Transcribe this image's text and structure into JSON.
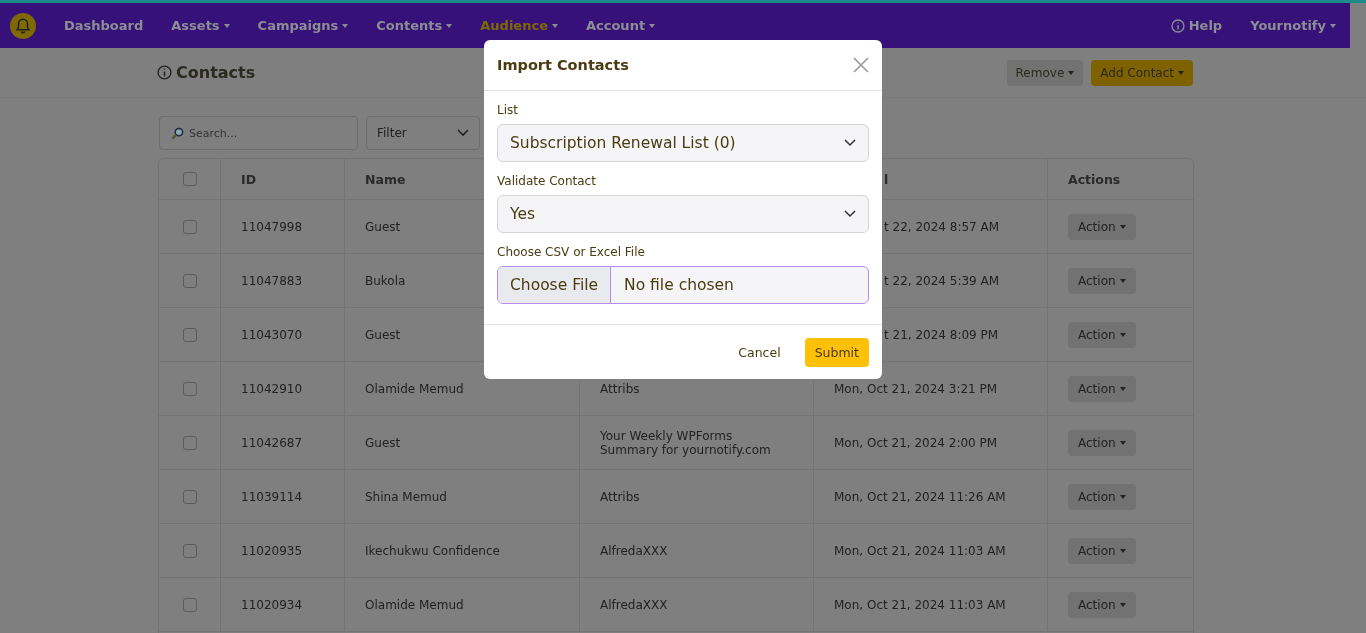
{
  "nav": {
    "items": [
      {
        "label": "Dashboard",
        "dropdown": false,
        "selected": false
      },
      {
        "label": "Assets",
        "dropdown": true,
        "selected": false
      },
      {
        "label": "Campaigns",
        "dropdown": true,
        "selected": false
      },
      {
        "label": "Contents",
        "dropdown": true,
        "selected": false
      },
      {
        "label": "Audience",
        "dropdown": true,
        "selected": true
      },
      {
        "label": "Account",
        "dropdown": true,
        "selected": false
      }
    ],
    "help": "Help",
    "account": "Yournotify"
  },
  "page": {
    "title": "Contacts",
    "buttons": [
      {
        "label": "Remove",
        "kind": "secondary"
      },
      {
        "label": "Add Contact",
        "kind": "primary"
      }
    ]
  },
  "toolbar": {
    "search": {
      "placeholder": "Search..."
    },
    "filter": {
      "value": "Filter"
    }
  },
  "table": {
    "header_checked": false,
    "columns": [
      "ID",
      "Name",
      "",
      "l",
      "Actions"
    ],
    "rows": [
      {
        "checked": false,
        "id": "11047998",
        "name": "Guest",
        "column_4": "t 22, 2024 8:57 AM",
        "action": "Action"
      },
      {
        "checked": false,
        "id": "11047883",
        "name": "Bukola",
        "column_4": "t 22, 2024 5:39 AM",
        "action": "Action"
      },
      {
        "checked": false,
        "id": "11043070",
        "name": "Guest",
        "column_4": "t 21, 2024 8:09 PM",
        "action": "Action"
      },
      {
        "checked": false,
        "id": "11042910",
        "name": "Olamide Memud",
        "column_3": "Attribs",
        "column_4": "Mon, Oct 21, 2024 3:21 PM",
        "action": "Action"
      },
      {
        "checked": false,
        "id": "11042687",
        "name": "Guest",
        "column_3": "Your Weekly WPForms Summary for yournotify.com",
        "column_4": "Mon, Oct 21, 2024 2:00 PM",
        "action": "Action"
      },
      {
        "checked": false,
        "id": "11039114",
        "name": "Shina Memud",
        "column_3": "Attribs",
        "column_4": "Mon, Oct 21, 2024 11:26 AM",
        "action": "Action"
      },
      {
        "checked": false,
        "id": "11020935",
        "name": "Ikechukwu Confidence",
        "column_3": "AlfredaXXX",
        "column_4": "Mon, Oct 21, 2024 11:03 AM",
        "action": "Action"
      },
      {
        "checked": false,
        "id": "11020934",
        "name": "Olamide Memud",
        "column_3": "AlfredaXXX",
        "column_4": "Mon, Oct 21, 2024 11:03 AM",
        "action": "Action"
      }
    ]
  },
  "modal": {
    "title": "Import Contacts",
    "fields": [
      {
        "kind": "select",
        "label": "List",
        "value": "Subscription Renewal List (0)"
      },
      {
        "kind": "select",
        "label": "Validate Contact",
        "value": "Yes"
      },
      {
        "kind": "file",
        "label": "Choose CSV or Excel File",
        "button": "Choose File",
        "value": "No file chosen"
      }
    ],
    "buttons": [
      {
        "label": "Cancel",
        "kind": "link"
      },
      {
        "label": "Submit",
        "kind": "primary"
      }
    ]
  }
}
